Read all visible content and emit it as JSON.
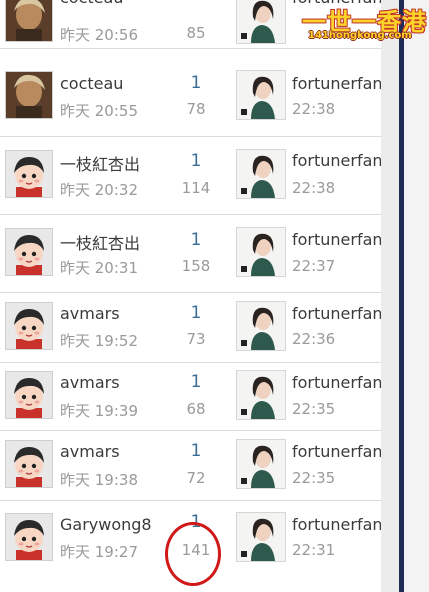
{
  "rows": [
    {
      "author": "cocteau",
      "time": "昨天 20:56",
      "replies": "",
      "views": "85",
      "last_author": "fortunerfan",
      "last_time": "",
      "avatar": "photo-avatar"
    },
    {
      "author": "cocteau",
      "time": "昨天 20:55",
      "replies": "1",
      "views": "78",
      "last_author": "fortunerfan",
      "last_time": "22:38",
      "avatar": "photo-avatar"
    },
    {
      "author": "一枝紅杏出",
      "time": "昨天 20:32",
      "replies": "1",
      "views": "114",
      "last_author": "fortunerfan",
      "last_time": "22:38",
      "avatar": "cartoon-avatar"
    },
    {
      "author": "一枝紅杏出",
      "time": "昨天 20:31",
      "replies": "1",
      "views": "158",
      "last_author": "fortunerfan",
      "last_time": "22:37",
      "avatar": "cartoon-avatar"
    },
    {
      "author": "avmars",
      "time": "昨天 19:52",
      "replies": "1",
      "views": "73",
      "last_author": "fortunerfan",
      "last_time": "22:36",
      "avatar": "cartoon-avatar"
    },
    {
      "author": "avmars",
      "time": "昨天 19:39",
      "replies": "1",
      "views": "68",
      "last_author": "fortunerfan",
      "last_time": "22:35",
      "avatar": "cartoon-avatar"
    },
    {
      "author": "avmars",
      "time": "昨天 19:38",
      "replies": "1",
      "views": "72",
      "last_author": "fortunerfan",
      "last_time": "22:35",
      "avatar": "cartoon-avatar"
    },
    {
      "author": "Garywong8",
      "time": "昨天 19:27",
      "replies": "1",
      "views": "141",
      "last_author": "fortunerfan",
      "last_time": "22:31",
      "avatar": "cartoon-avatar"
    }
  ],
  "watermark": {
    "title": "一世一香港",
    "url": "141hongkong.com"
  },
  "colors": {
    "reply": "#3a6d96",
    "rail": "#1e2c55",
    "highlight": "#d01818",
    "watermark": "#ffd42a"
  }
}
